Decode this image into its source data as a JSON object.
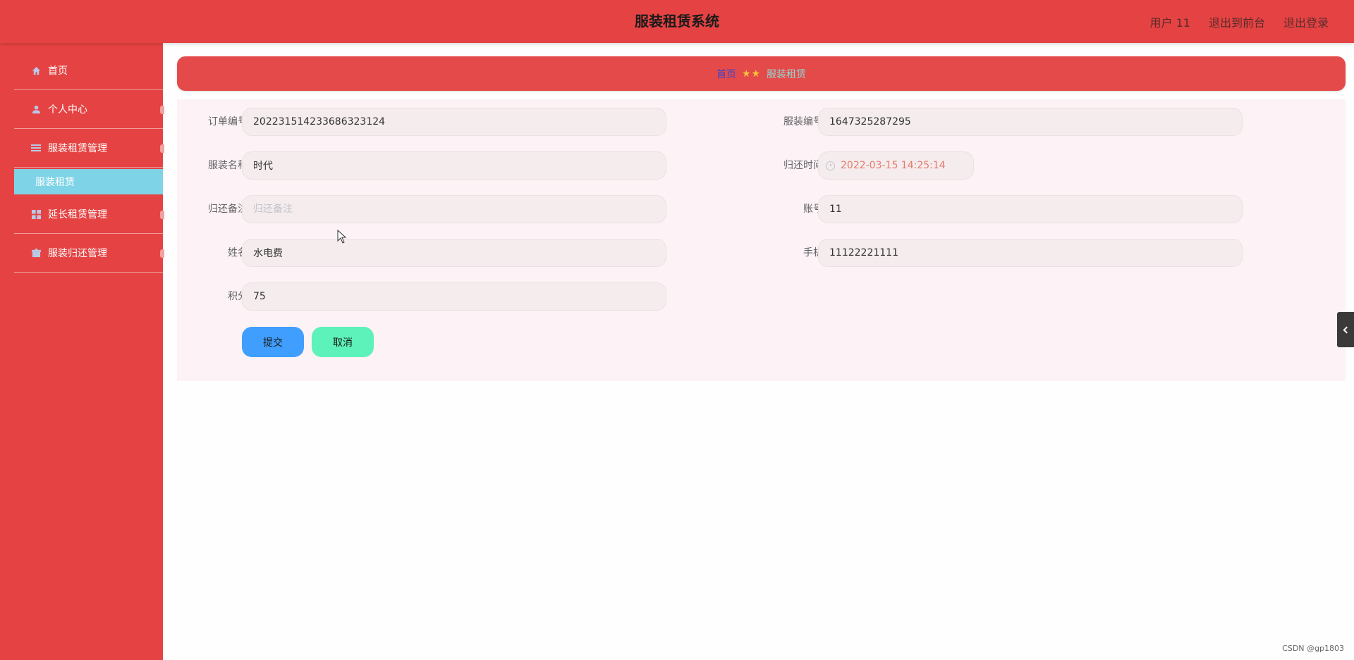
{
  "header": {
    "title": "服装租赁系统",
    "user_label": "用户 11",
    "front_label": "退出到前台",
    "logout_label": "退出登录"
  },
  "sidebar": {
    "items": [
      {
        "label": "首页",
        "icon": "home-icon"
      },
      {
        "label": "个人中心",
        "icon": "user-icon"
      },
      {
        "label": "服装租赁管理",
        "icon": "menu-icon"
      },
      {
        "label": "延长租赁管理",
        "icon": "grid-icon"
      },
      {
        "label": "服装归还管理",
        "icon": "box-icon"
      }
    ],
    "sub_item": {
      "label": "服装租赁"
    }
  },
  "breadcrumb": {
    "home": "首页",
    "separator": "★★",
    "current": "服装租赁"
  },
  "form": {
    "order_no": {
      "label": "订单编号",
      "value": "202231514233686323124"
    },
    "clothing_no": {
      "label": "服装编号",
      "value": "1647325287295"
    },
    "clothing_name": {
      "label": "服装名称",
      "value": "时代"
    },
    "return_time": {
      "label": "归还时间",
      "value": "2022-03-15 14:25:14"
    },
    "return_note": {
      "label": "归还备注",
      "placeholder": "归还备注",
      "value": ""
    },
    "account": {
      "label": "账号",
      "value": "11"
    },
    "name": {
      "label": "姓名",
      "value": "水电费"
    },
    "phone": {
      "label": "手机",
      "value": "11122221111"
    },
    "points": {
      "label": "积分",
      "value": "75"
    },
    "submit_label": "提交",
    "cancel_label": "取消"
  },
  "watermark": "CSDN @gp1803",
  "colors": {
    "primary_red": "#e54343",
    "submenu_active": "#7fd3e6",
    "submit_blue": "#409eff",
    "cancel_green": "#5cf2b9"
  }
}
